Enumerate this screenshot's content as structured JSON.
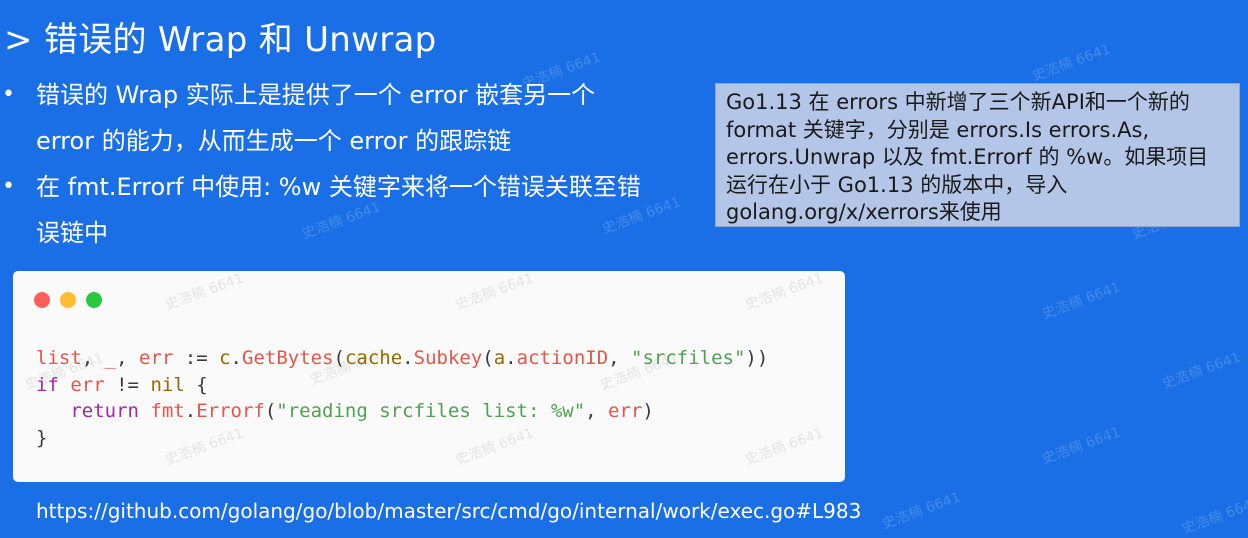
{
  "slide": {
    "title": "> 错误的 Wrap 和 Unwrap",
    "bullets": [
      {
        "marker": "•",
        "text": "错误的 Wrap 实际上是提供了一个 error 嵌套另一个 error 的能力，从而生成一个 error 的跟踪链"
      },
      {
        "marker": "•",
        "text": "在 fmt.Errorf 中使用: %w 关键字来将一个错误关联至错误链中"
      }
    ],
    "note": "Go1.13 在 errors 中新增了三个新API和一个新的 format 关键字，分别是 errors.Is errors.As, errors.Unwrap 以及 fmt.Errorf 的 %w。如果项目运行在小于 Go1.13 的版本中，导入 golang.org/x/xerrors来使用",
    "url": "https://github.com/golang/go/blob/master/src/cmd/go/internal/work/exec.go#L983",
    "watermark": "史浩楠 6641"
  },
  "code": {
    "line1": {
      "a": "list",
      "b": ", ",
      "c": "_",
      "d": ", ",
      "e": "err",
      "f": " := ",
      "g": "c",
      "h": ".",
      "i": "GetBytes",
      "j": "(",
      "k": "cache",
      "l": ".",
      "m": "Subkey",
      "n": "(",
      "o": "a",
      "p": ".",
      "q": "actionID",
      "r": ", ",
      "s": "\"srcfiles\"",
      "t": "))"
    },
    "line2": {
      "a": "if",
      "b": " ",
      "c": "err",
      "d": " != ",
      "e": "nil",
      "f": " {"
    },
    "line3": {
      "indent": "   ",
      "a": "return",
      "b": " ",
      "c": "fmt",
      "d": ".",
      "e": "Errorf",
      "f": "(",
      "g": "\"reading srcfiles list: %w\"",
      "h": ", ",
      "i": "err",
      "j": ")"
    },
    "line4": "}"
  },
  "colors": {
    "background": "#1a6fe6",
    "note_background": "#b4c6e7",
    "traffic_red": "#ff5f57",
    "traffic_yellow": "#febc2e",
    "traffic_green": "#28c840"
  }
}
